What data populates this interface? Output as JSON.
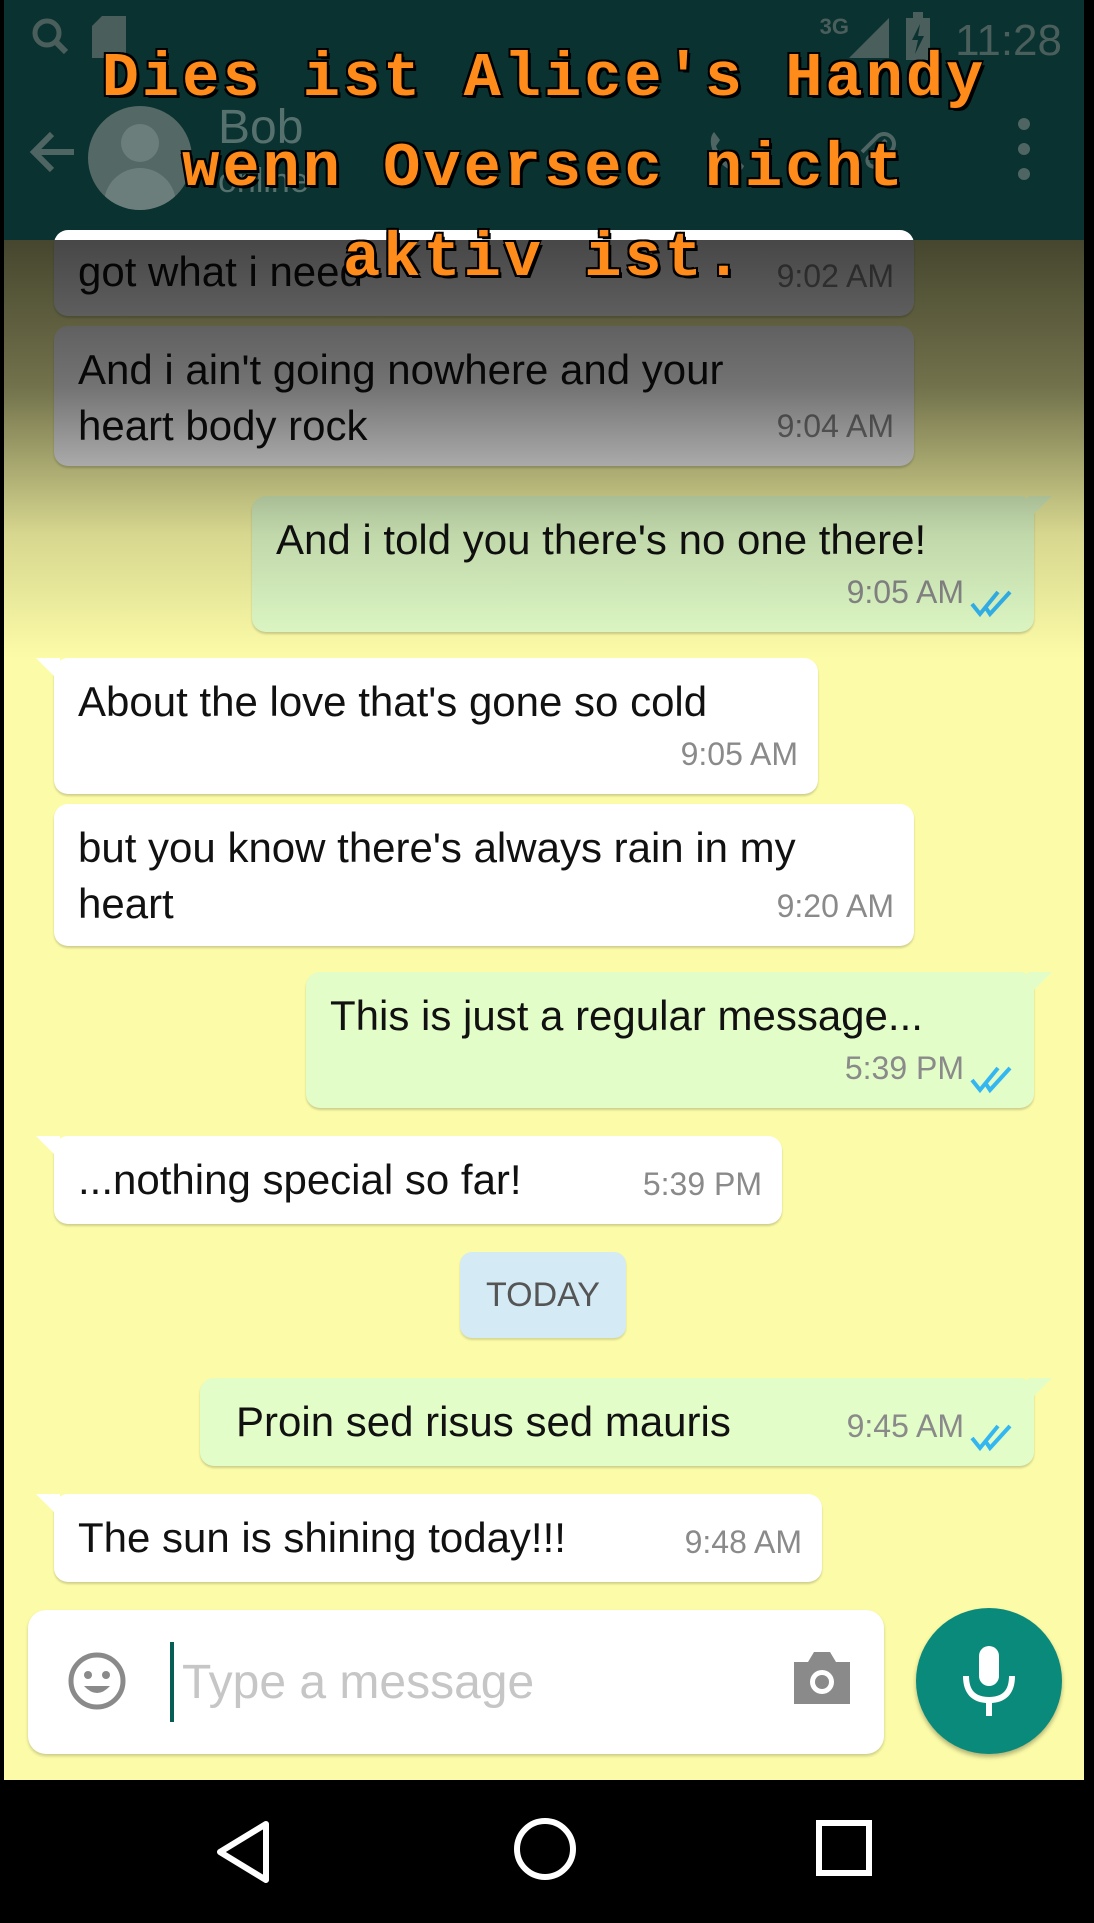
{
  "status_bar": {
    "time": "11:28",
    "network": "3G",
    "left_icons": [
      "search-status-icon",
      "sd-card-icon"
    ],
    "right_icons": [
      "signal-icon",
      "battery-charging-icon"
    ]
  },
  "header": {
    "contact_name": "Bob",
    "contact_status": "online",
    "icons": [
      "back-arrow-icon",
      "avatar-icon",
      "call-icon",
      "attach-icon",
      "more-vert-icon"
    ]
  },
  "overlay_banner": {
    "lines": [
      "Dies ist Alice's Handy",
      "wenn Oversec nicht",
      "aktiv ist."
    ],
    "color": "#ff8c1a"
  },
  "messages": [
    {
      "direction": "in",
      "text": "got what i need",
      "time": "9:02 AM"
    },
    {
      "direction": "in",
      "text": "And i ain't going nowhere and your heart body rock",
      "time": "9:04 AM"
    },
    {
      "direction": "out",
      "text": "And i told you there's no one there!",
      "time": "9:05 AM",
      "status": "read"
    },
    {
      "direction": "in",
      "text": "About the love that's gone so cold",
      "time": "9:05 AM"
    },
    {
      "direction": "in",
      "text": "but you know there's always rain in my heart",
      "time": "9:20 AM"
    },
    {
      "direction": "out",
      "text": "This is just a regular message...",
      "time": "5:39 PM",
      "status": "read"
    },
    {
      "direction": "in",
      "text": "...nothing special so far!",
      "time": "5:39 PM"
    },
    {
      "direction": "out",
      "text": "Proin sed risus sed mauris",
      "time": "9:45 AM",
      "status": "read"
    },
    {
      "direction": "in",
      "text": "The sun is shining today!!!",
      "time": "9:48 AM"
    }
  ],
  "day_separator": "TODAY",
  "composer": {
    "placeholder": "Type a message",
    "value": "",
    "icons": [
      "emoji-icon",
      "camera-icon",
      "mic-icon"
    ]
  },
  "nav_bar": {
    "icons": [
      "back-triangle-icon",
      "home-circle-icon",
      "recents-square-icon"
    ]
  },
  "colors": {
    "chat_background": "#fcfca8",
    "incoming_bubble": "#ffffff",
    "outgoing_bubble": "#e2fdc8",
    "read_ticks": "#34b7f1",
    "accent": "#0a8a7a",
    "header": "#0a3230"
  }
}
